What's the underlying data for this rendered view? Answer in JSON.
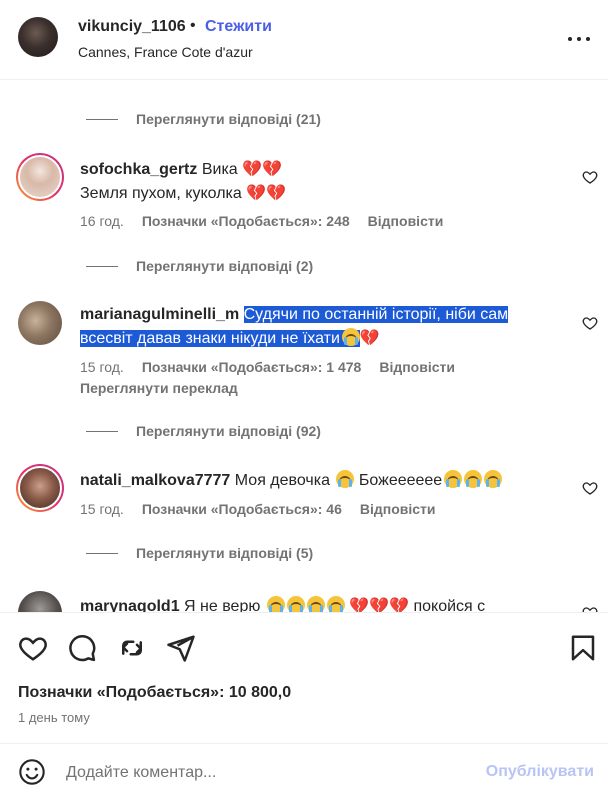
{
  "header": {
    "username": "vikunciy_1106",
    "separator": "•",
    "follow_label": "Стежити",
    "location": "Cannes, France Cote d'azur",
    "more_icon": "more-horizontal-icon"
  },
  "comments": {
    "view_replies_1": "Переглянути відповіді (21)",
    "c1": {
      "username": "sofochka_gertz",
      "line1": "Вика",
      "line1_emoji": "💔💔",
      "line2": "Земля пухом, куколка",
      "line2_emoji": "💔💔",
      "time": "16 год.",
      "likes": "Позначки «Подобається»: 248",
      "reply": "Відповісти"
    },
    "view_replies_2": "Переглянути відповіді (2)",
    "c2": {
      "username": "marianagulminelli_m",
      "text": "Судячи по останній історії, ніби сам всесвіт давав знаки нікуди не їхати",
      "emoji_end": "💔",
      "time": "15 год.",
      "likes": "Позначки «Подобається»: 1 478",
      "reply": "Відповісти",
      "translate": "Переглянути переклад"
    },
    "view_replies_3": "Переглянути відповіді (92)",
    "c3": {
      "username": "natali_malkova7777",
      "text_a": "Моя девочка",
      "text_b": "Божееееее",
      "time": "15 год.",
      "likes": "Позначки «Подобається»: 46",
      "reply": "Відповісти"
    },
    "view_replies_4": "Переглянути відповіді (5)",
    "c4": {
      "username": "marynagold1",
      "text_a": "Я не верю",
      "hearts": "💔💔💔",
      "text_b": "покойся с"
    }
  },
  "actions": {
    "like_icon": "heart-icon",
    "comment_icon": "comment-icon",
    "repost_icon": "repost-icon",
    "share_icon": "send-icon",
    "save_icon": "bookmark-icon",
    "likes_count": "Позначки «Подобається»: 10 800,0",
    "posted_ago": "1 день тому"
  },
  "composer": {
    "emoji_icon": "smiley-icon",
    "placeholder": "Додайте коментар...",
    "publish_label": "Опублікувати"
  },
  "colors": {
    "link": "#4a5ee8",
    "muted": "#737373",
    "highlight": "#1d5ad6",
    "publish_disabled": "#b8c4f5"
  }
}
